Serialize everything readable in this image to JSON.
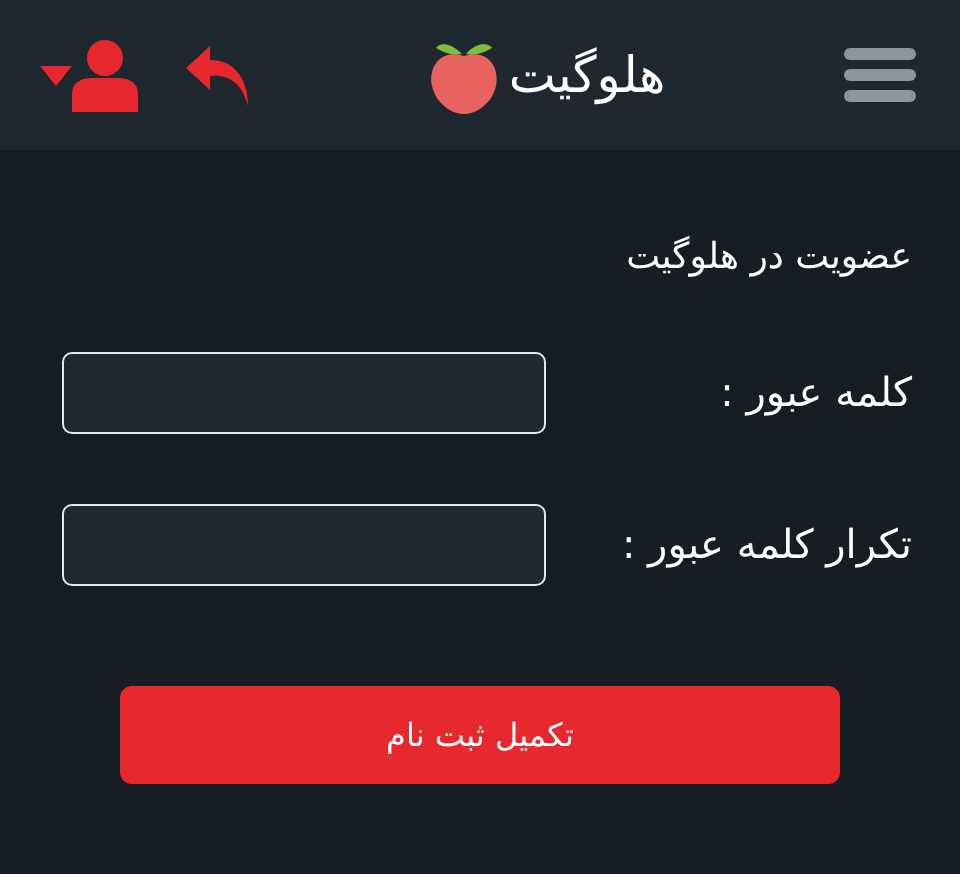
{
  "header": {
    "title": "هلوگیت"
  },
  "heading": "عضویت در هلوگیت",
  "fields": [
    {
      "label": "کلمه عبور :"
    },
    {
      "label": "تکرار کلمه عبور :"
    }
  ],
  "submit": "تکمیل ثبت نام"
}
